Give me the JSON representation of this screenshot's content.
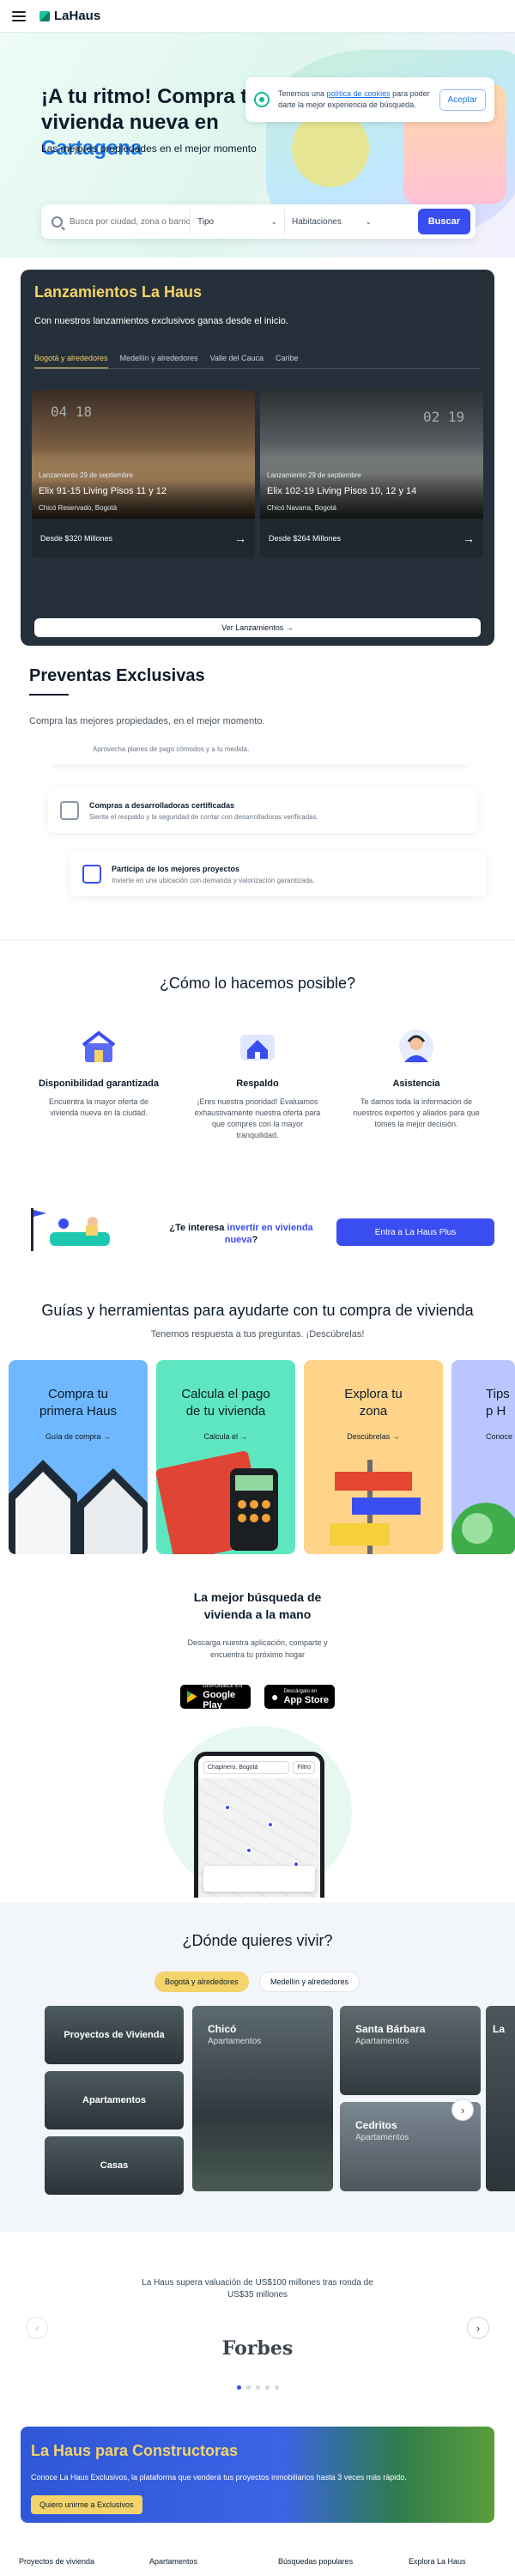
{
  "header": {
    "logo": "LaHaus"
  },
  "cookie": {
    "text_pre": "Tenemos una ",
    "link": "política de cookies",
    "text_post": " para poder darte la mejor experiencia de búsqueda.",
    "accept": "Aceptar"
  },
  "hero": {
    "title": "¡A tu ritmo! Compra tu vivienda nueva en ",
    "city": "Cartagena",
    "subtitle": "Las mejores propiedades en el mejor momento"
  },
  "search": {
    "placeholder": "Busca por ciudad, zona o barrio",
    "type": "Tipo",
    "rooms": "Habitaciones",
    "button": "Buscar"
  },
  "lanzamientos": {
    "title": "Lanzamientos La Haus",
    "subtitle": "Con nuestros lanzamientos exclusivos ganas desde el inicio.",
    "tabs": [
      "Bogotá y alrededores",
      "Medellín y alrededores",
      "Valle del Cauca",
      "Caribe"
    ],
    "cards": [
      {
        "date": "Lanzamiento 29 de septiembre",
        "name": "Elix 91-15 Living Pisos 11 y 12",
        "location": "Chicó Reservado, Bogotá",
        "price": "Desde $320 Millones",
        "clock": "04 18"
      },
      {
        "date": "Lanzamiento 29 de septiembre",
        "name": "Elix 102-19 Living Pisos 10, 12 y 14",
        "location": "Chicó Navarra, Bogotá",
        "price": "Desde $264 Millones",
        "clock": "02 19"
      }
    ],
    "more": "Ver Lanzamientos"
  },
  "preventas": {
    "title": "Preventas Exclusivas",
    "subtitle": "Compra las mejores propiedades, en el mejor momento.",
    "features": [
      {
        "title": "",
        "desc": "Aprovecha planes de pago cómodos y a tu medida."
      },
      {
        "title": "Compras a desarrolladoras certificadas",
        "desc": "Siente el respaldo y la seguridad de contar con desarrolladoras verificadas."
      },
      {
        "title": "Participa de los mejores proyectos",
        "desc": "Invierte en una ubicación con demanda y valorización garantizada."
      }
    ]
  },
  "como": {
    "title": "¿Cómo lo hacemos posible?",
    "items": [
      {
        "title": "Disponibilidad garantizada",
        "desc": "Encuentra la mayor oferta de vivienda nueva en la ciudad."
      },
      {
        "title": "Respaldo",
        "desc": "¡Eres nuestra prioridad! Evaluamos exhaustivamente nuestra oferta para que compres con la mayor tranquilidad."
      },
      {
        "title": "Asistencia",
        "desc": "Te damos toda la información de nuestros expertos y aliados para que tomes la mejor decisión."
      }
    ],
    "plus_q_pre": "¿Te interesa ",
    "plus_q_hl": "invertir en vivienda nueva",
    "plus_q_post": "?",
    "plus_button": "Entra a La Haus Plus"
  },
  "guias": {
    "title": "Guías y herramientas para ayudarte con tu compra de vivienda",
    "subtitle": "Tenemos respuesta a tus preguntas. ¡Descúbrelas!",
    "cards": [
      {
        "title": "Compra tu primera Haus",
        "link": "Guía de compra →"
      },
      {
        "title": "Calcula el pago de tu vivienda",
        "link": "Calcula el →"
      },
      {
        "title": "Explora tu zona",
        "link": "Descúbrelas →"
      },
      {
        "title": "Tips p H",
        "link": "Conoce"
      }
    ]
  },
  "app": {
    "title": "La mejor búsqueda de vivienda a la mano",
    "subtitle": "Descarga nuestra aplicación, comparte y encuentra tu próximo hogar",
    "google_small": "DISPONIBLE EN",
    "google": "Google Play",
    "apple_small": "Descárgalo en",
    "apple": "App Store",
    "phone_search": "Chapinero, Bogotá",
    "phone_filter": "Filtro"
  },
  "donde": {
    "title": "¿Dónde quieres vivir?",
    "tabs": [
      "Bogotá y alrededores",
      "Medellín y alrededores"
    ],
    "left": [
      "Proyectos de Vivienda",
      "Apartamentos",
      "Casas"
    ],
    "big": {
      "name": "Chicó",
      "sub": "Apartamentos"
    },
    "small": [
      {
        "name": "Santa Bárbara",
        "sub": "Apartamentos"
      },
      {
        "name": "Cedritos",
        "sub": "Apartamentos"
      }
    ],
    "peek": "La"
  },
  "valuacion": {
    "text": "La Haus supera valuación de US$100 millones tras ronda de US$35 millones",
    "logo": "Forbes"
  },
  "constructoras": {
    "title": "La Haus para Constructoras",
    "subtitle": "Conoce La Haus Exclusivos, la plataforma que venderá tus proyectos inmobiliarios hasta 3 veces más rápido.",
    "button": "Quiero unirme a Exclusivos"
  },
  "footer": [
    "Proyectos de vivienda",
    "Apartamentos",
    "Búsquedas populares",
    "Explora La Haus"
  ],
  "colors": {
    "accent": "#3a4df0",
    "brand": "#1cc39a",
    "yellow": "#f3d36a",
    "dark": "#25303a"
  }
}
